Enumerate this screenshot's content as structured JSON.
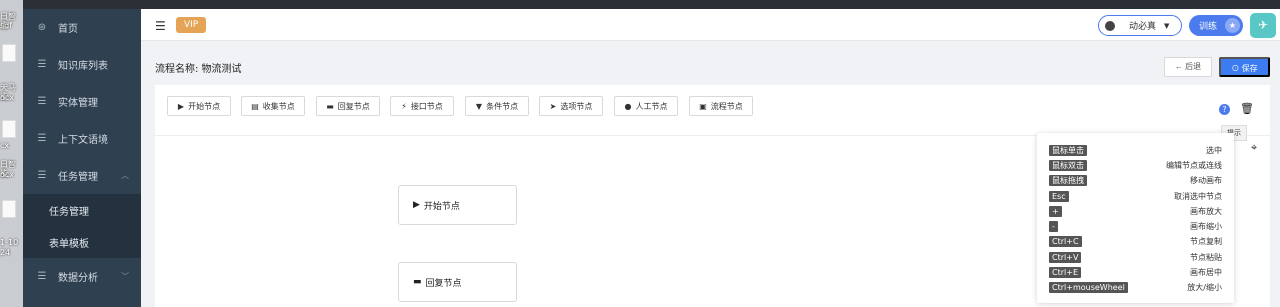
{
  "desktop": {
    "files": [
      "日智能",
      "sdf",
      "天马能",
      "ocx",
      "cx",
      "日智能",
      "ocx",
      "1-10",
      "24"
    ]
  },
  "sidebar": {
    "items": [
      {
        "label": "首页",
        "icon": "dashboard-icon"
      },
      {
        "label": "知识库列表",
        "icon": "list-icon"
      },
      {
        "label": "实体管理",
        "icon": "list-icon"
      },
      {
        "label": "上下文语境",
        "icon": "list-icon"
      },
      {
        "label": "任务管理",
        "icon": "list-icon",
        "expanded": true
      }
    ],
    "sub_items": [
      {
        "label": "任务管理"
      },
      {
        "label": "表单模板"
      }
    ],
    "bottom_item": {
      "label": "数据分析",
      "icon": "list-icon"
    }
  },
  "header": {
    "vip_label": "VIP",
    "user_name": "动必真",
    "train_label": "训练"
  },
  "page": {
    "flow_title": "流程名称: 物流测试",
    "back_label": "← 后退",
    "save_label": "⊙ 保存"
  },
  "toolbar": {
    "nodes": [
      {
        "label": "开始节点",
        "icon": "play-icon"
      },
      {
        "label": "收集节点",
        "icon": "form-icon"
      },
      {
        "label": "回复节点",
        "icon": "message-icon"
      },
      {
        "label": "接口节点",
        "icon": "plug-icon"
      },
      {
        "label": "条件节点",
        "icon": "filter-icon"
      },
      {
        "label": "选项节点",
        "icon": "cursor-icon"
      },
      {
        "label": "人工节点",
        "icon": "user-icon"
      },
      {
        "label": "流程节点",
        "icon": "flow-icon"
      }
    ]
  },
  "tooltip": "提示",
  "canvas": {
    "nodes": [
      {
        "label": "开始节点",
        "icon": "play-icon"
      },
      {
        "label": "回复节点",
        "icon": "message-icon"
      }
    ]
  },
  "shortcuts": [
    {
      "key": "鼠标单击",
      "desc": "选中"
    },
    {
      "key": "鼠标双击",
      "desc": "编辑节点或连线"
    },
    {
      "key": "鼠标拖拽",
      "desc": "移动画布"
    },
    {
      "key": "Esc",
      "desc": "取消选中节点"
    },
    {
      "key": "+",
      "desc": "画布放大"
    },
    {
      "key": "-",
      "desc": "画布缩小"
    },
    {
      "key": "Ctrl+C",
      "desc": "节点复制"
    },
    {
      "key": "Ctrl+V",
      "desc": "节点粘贴"
    },
    {
      "key": "Ctrl+E",
      "desc": "画布居中"
    },
    {
      "key": "Ctrl+mouseWheel",
      "desc": "放大/缩小"
    }
  ]
}
